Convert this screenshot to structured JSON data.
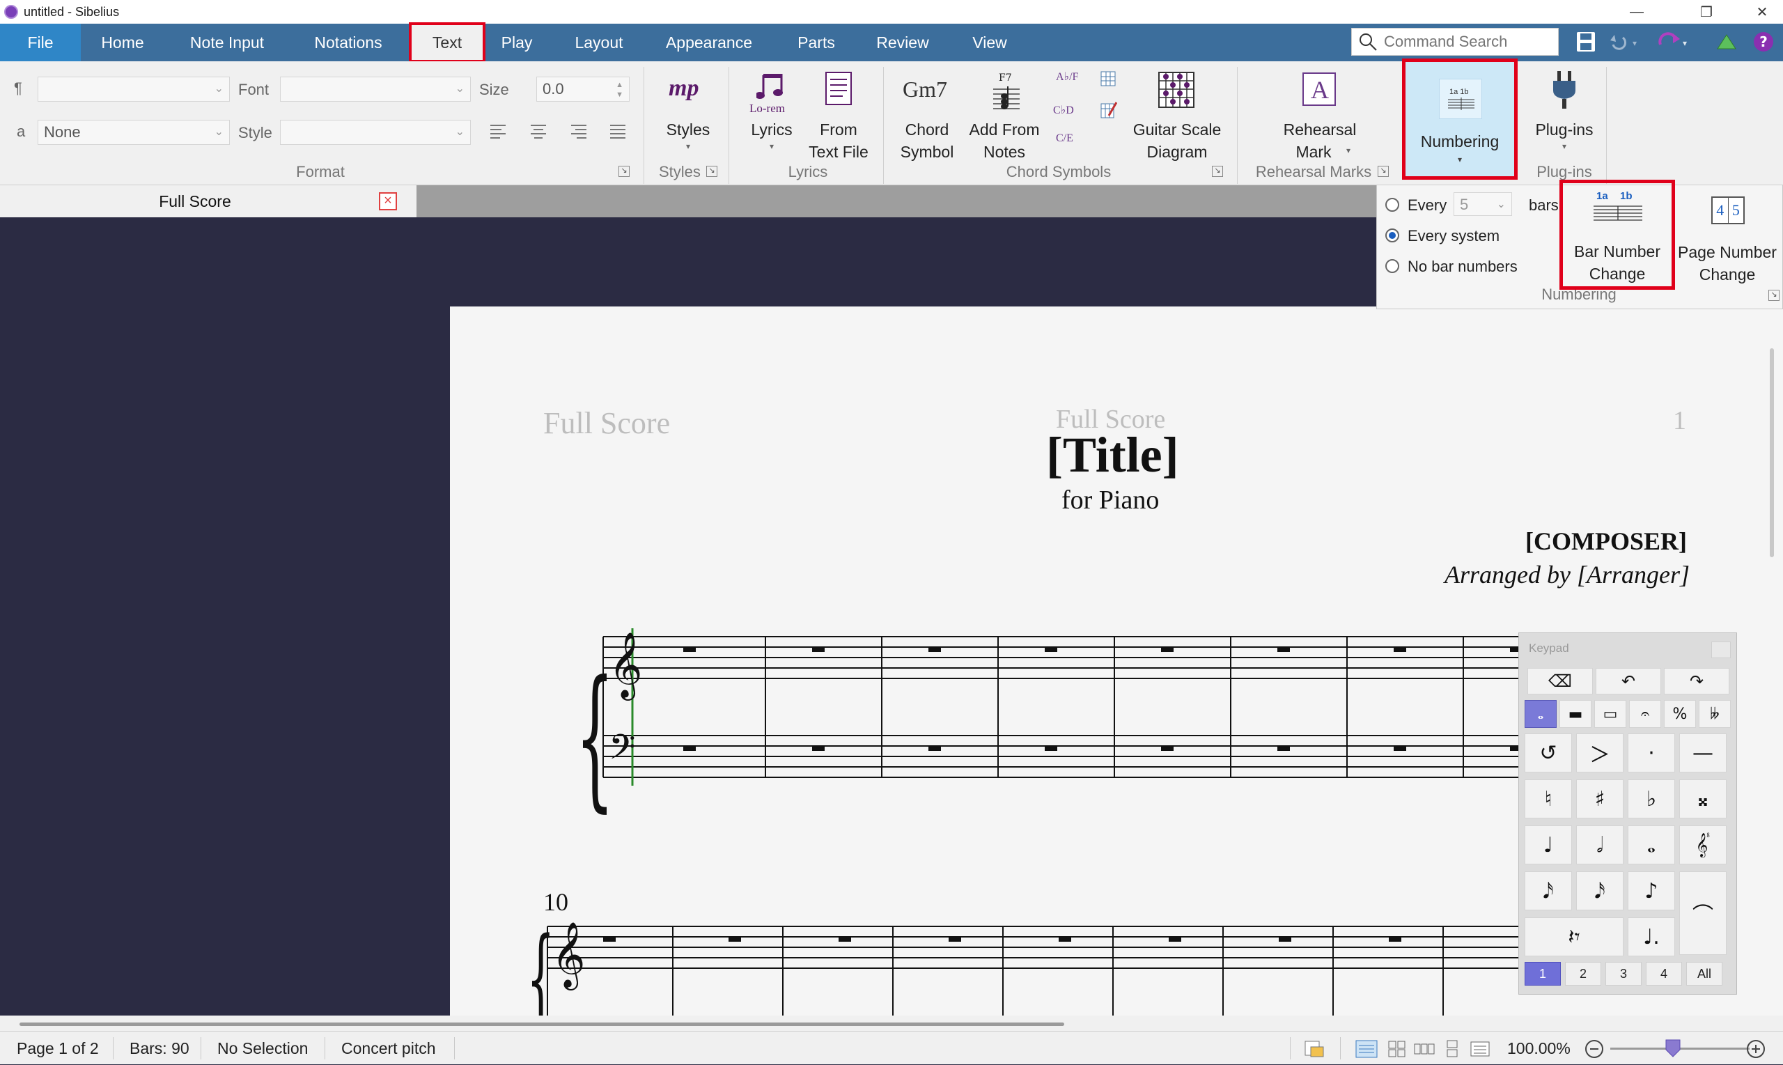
{
  "window": {
    "title": "untitled - Sibelius"
  },
  "menu": {
    "tabs": [
      "File",
      "Home",
      "Note Input",
      "Notations",
      "Text",
      "Play",
      "Layout",
      "Appearance",
      "Parts",
      "Review",
      "View"
    ],
    "active_tab": "Text"
  },
  "search": {
    "placeholder": "Command Search"
  },
  "format": {
    "font_label": "Font",
    "size_label": "Size",
    "size_value": "0.0",
    "style_label": "Style",
    "style_combo_value": "None",
    "group_label": "Format",
    "para_glyph": "¶",
    "a_glyph": "a"
  },
  "styles_group": {
    "button": "Styles",
    "icon_text": "mp",
    "group_label": "Styles"
  },
  "lyrics_group": {
    "lyrics_button": "Lyrics",
    "lyrics_icon_text": "Lo-rem",
    "from_text_file": [
      "From",
      "Text File"
    ],
    "group_label": "Lyrics"
  },
  "chord_group": {
    "chord_symbol": [
      "Chord",
      "Symbol"
    ],
    "chord_icon_text": "Gm7",
    "add_from_notes": [
      "Add From",
      "Notes"
    ],
    "guitar_scale": [
      "Guitar Scale",
      "Diagram"
    ],
    "small_icons": [
      "A♭/F",
      "C♭D",
      "C/E"
    ],
    "group_label": "Chord Symbols"
  },
  "rehearsal_group": {
    "button": [
      "Rehearsal",
      "Mark"
    ],
    "icon_text": "A",
    "group_label": "Rehearsal Marks"
  },
  "numbering_group": {
    "button": "Numbering",
    "icon_text": "1a 1b",
    "every_label": "Every",
    "every_value": "5",
    "bars_label": "bars",
    "options": [
      "Every system",
      "No bar numbers"
    ],
    "selected_option": "Every system",
    "bar_number_change": [
      "Bar Number",
      "Change"
    ],
    "bar_number_icon": [
      "1a",
      "1b"
    ],
    "page_number_change": [
      "Page Number",
      "Change"
    ],
    "page_number_icon": [
      "4",
      "5"
    ],
    "group_label": "Numbering"
  },
  "plugins_group": {
    "button": "Plug-ins",
    "group_label": "Plug-ins"
  },
  "document_tab": {
    "label": "Full Score"
  },
  "score": {
    "header_left": "Full Score",
    "header_center": "Full Score",
    "page_number": "1",
    "title": "[Title]",
    "subtitle": "for Piano",
    "composer": "[COMPOSER]",
    "arranger": "Arranged by [Arranger]",
    "system2_bar_number": "10"
  },
  "keypad": {
    "title": "Keypad",
    "row1": [
      "⌫",
      "↶",
      "↷"
    ],
    "row2": [
      "𝅝",
      "▬",
      "▭",
      "𝄐",
      "%",
      "𝄫"
    ],
    "row3": [
      "↺",
      "＞",
      "·",
      "—"
    ],
    "row4": [
      "♮",
      "♯",
      "♭",
      "𝄪"
    ],
    "row5": [
      "♩",
      "𝅗𝅥",
      "𝅝",
      "𝄟"
    ],
    "row6": [
      "𝅘𝅥𝅯",
      "𝅘𝅥𝅯",
      "♪",
      "⌒"
    ],
    "row7": [
      "𝄽𝄾",
      "♩."
    ],
    "tabs": [
      "1",
      "2",
      "3",
      "4",
      "All"
    ],
    "selected_tab": "1"
  },
  "status": {
    "page": "Page 1 of 2",
    "bars": "Bars: 90",
    "selection": "No Selection",
    "pitch": "Concert pitch",
    "zoom": "100.00%"
  },
  "colors": {
    "menubar": "#3c6e9c",
    "file_tab": "#2f86c7",
    "highlight_box": "#e0001a",
    "workspace": "#2b2b43",
    "keypad_selected": "#7a7ad8"
  }
}
